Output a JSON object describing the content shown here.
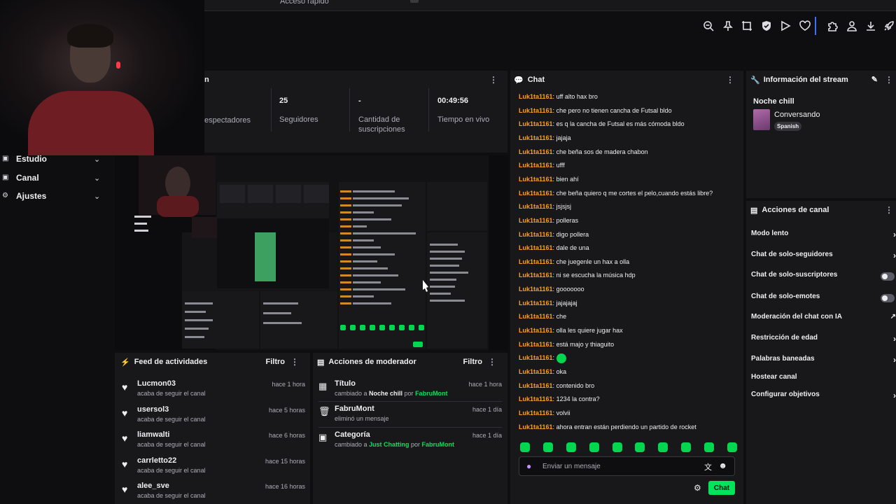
{
  "tabstrip": {
    "label": "Acceso rápido"
  },
  "toolbar": {
    "icons": [
      "zoom-out-icon",
      "pin-icon",
      "crop-icon",
      "shield-check-icon",
      "play-icon",
      "heart-icon",
      "puzzle-icon",
      "profile-icon",
      "download-icon",
      "rocket-icon"
    ]
  },
  "nav": {
    "items": [
      {
        "label": "Estudio"
      },
      {
        "label": "Canal"
      },
      {
        "label": "Ajustes"
      }
    ]
  },
  "stats": {
    "title_fragment": "n",
    "items": [
      {
        "value": "",
        "label": "espectadores"
      },
      {
        "value": "25",
        "label": "Seguidores"
      },
      {
        "value": "-",
        "label": "Cantidad de suscripciones"
      },
      {
        "value": "00:49:56",
        "label": "Tiempo en vivo"
      }
    ]
  },
  "feed": {
    "title": "Feed de actividades",
    "filter_label": "Filtro",
    "items": [
      {
        "user": "Lucmon03",
        "action": "acaba de seguir el canal",
        "time": "hace 1 hora"
      },
      {
        "user": "usersol3",
        "action": "acaba de seguir el canal",
        "time": "hace 5 horas"
      },
      {
        "user": "liamwalti",
        "action": "acaba de seguir el canal",
        "time": "hace 6 horas"
      },
      {
        "user": "carrletto22",
        "action": "acaba de seguir el canal",
        "time": "hace 15 horas"
      },
      {
        "user": "alee_sve",
        "action": "acaba de seguir el canal",
        "time": "hace 16 horas"
      }
    ]
  },
  "mod": {
    "title": "Acciones de moderador",
    "filter_label": "Filtro",
    "items": [
      {
        "title": "Título",
        "pre": "cambiado a ",
        "value": "Noche chill",
        "by": " por ",
        "author": "FabruMont",
        "time": "hace 1 hora"
      },
      {
        "title": "FabruMont",
        "pre": "eliminó un mensaje",
        "value": "",
        "by": "",
        "author": "",
        "time": "hace 1 día"
      },
      {
        "title": "Categoría",
        "pre": "cambiado a ",
        "value": "Just Chatting",
        "by": " por ",
        "author": "FabruMont",
        "time": "hace 1 día"
      }
    ]
  },
  "chat": {
    "title": "Chat",
    "input_placeholder": "Enviar un mensaje",
    "send_label": "Chat",
    "messages": [
      {
        "user": "Luk1ta1161",
        "text": "uff alto hax bro"
      },
      {
        "user": "Luk1ta1161",
        "text": "che pero no tienen cancha de Futsal bldo"
      },
      {
        "user": "Luk1ta1161",
        "text": "es q la cancha de Futsal es más cómoda bldo"
      },
      {
        "user": "Luk1ta1161",
        "text": "jajaja"
      },
      {
        "user": "Luk1ta1161",
        "text": "che beña sos de madera chabon"
      },
      {
        "user": "Luk1ta1161",
        "text": "ufff"
      },
      {
        "user": "Luk1ta1161",
        "text": "bien ahí"
      },
      {
        "user": "Luk1ta1161",
        "text": "che beña quiero q me cortes el pelo,cuando estás libre?"
      },
      {
        "user": "Luk1ta1161",
        "text": "jsjsjsj"
      },
      {
        "user": "Luk1ta1161",
        "text": "polleras"
      },
      {
        "user": "Luk1ta1161",
        "text": "digo pollera"
      },
      {
        "user": "Luk1ta1161",
        "text": "dale de una"
      },
      {
        "user": "Luk1ta1161",
        "text": "che juegenle un hax a olla"
      },
      {
        "user": "Luk1ta1161",
        "text": "ni se escucha la música hdp"
      },
      {
        "user": "Luk1ta1161",
        "text": "gooooooo"
      },
      {
        "user": "Luk1ta1161",
        "text": "jajajajaj"
      },
      {
        "user": "Luk1ta1161",
        "text": "che"
      },
      {
        "user": "Luk1ta1161",
        "text": "olla les quiere jugar hax"
      },
      {
        "user": "Luk1ta1161",
        "text": "está majo y thiaguito"
      },
      {
        "user": "Luk1ta1161",
        "text": ""
      },
      {
        "user": "Luk1ta1161",
        "text": "oka"
      },
      {
        "user": "Luk1ta1161",
        "text": "contenido bro"
      },
      {
        "user": "Luk1ta1161",
        "text": "1234 la contra?"
      },
      {
        "user": "Luk1ta1161",
        "text": "volvii"
      },
      {
        "user": "Luk1ta1161",
        "text": "ahora entran están perdiendo un partido de rocket"
      }
    ],
    "separator": ": "
  },
  "info": {
    "title": "Información del stream",
    "stream_title": "Noche chill",
    "category": "Conversando",
    "language_tag": "Spanish"
  },
  "chanact": {
    "title": "Acciones de canal",
    "items": [
      {
        "label": "Modo lento",
        "control": "chevron"
      },
      {
        "label": "Chat de solo-seguidores",
        "control": "chevron"
      },
      {
        "label": "Chat de solo-suscriptores",
        "control": "toggle"
      },
      {
        "label": "Chat de solo-emotes",
        "control": "toggle"
      },
      {
        "label": "Moderación del chat con IA",
        "control": "external"
      },
      {
        "label": "Restricción de edad",
        "control": "chevron"
      },
      {
        "label": "Palabras baneadas",
        "control": "chevron"
      },
      {
        "label": "Hostear canal",
        "control": "none"
      },
      {
        "label": "Configurar objetivos",
        "control": "chevron"
      }
    ]
  },
  "colors": {
    "accent": "#00e35a",
    "chat_user": "#ff9f1c",
    "panel": "#18181b",
    "bg": "#0e0e10"
  }
}
